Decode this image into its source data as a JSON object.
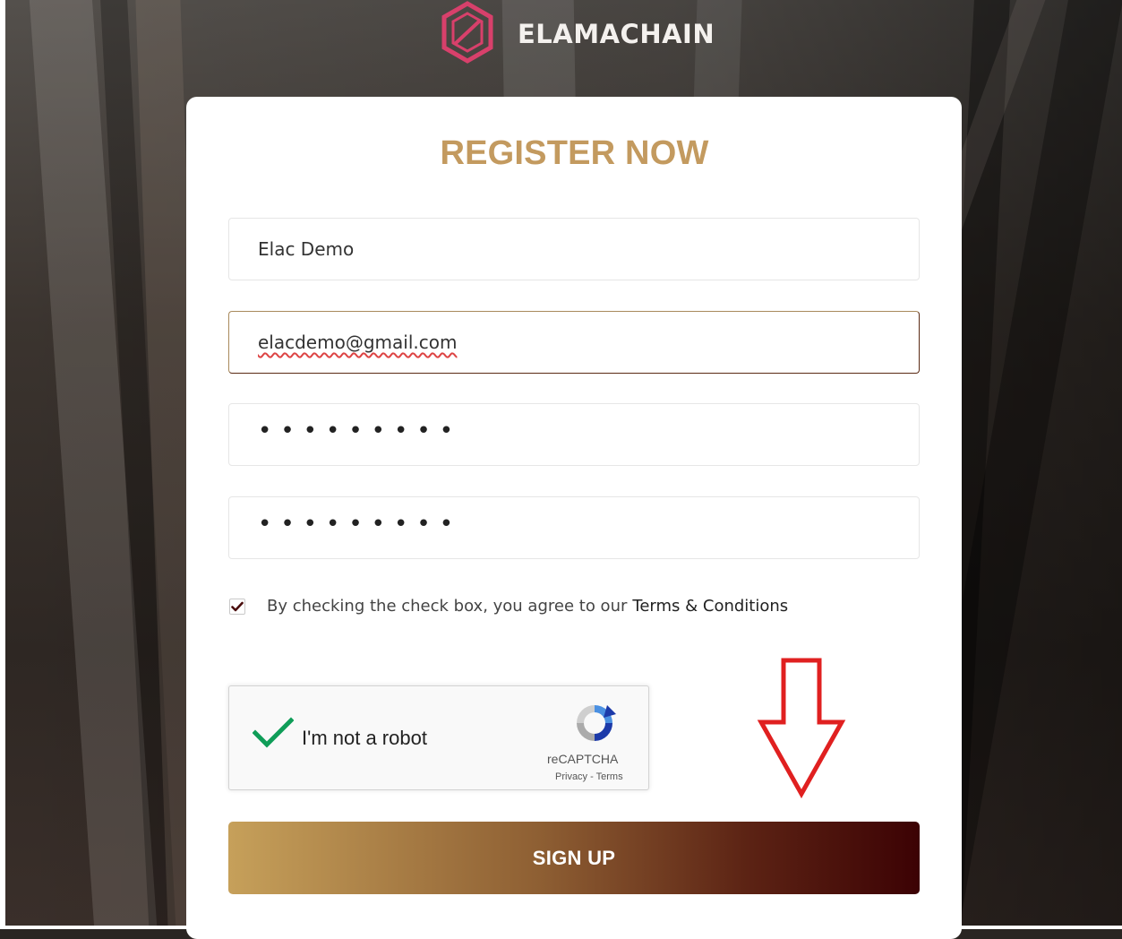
{
  "brand": {
    "name": "ELAMACHAIN",
    "logo_color": "#d8406b"
  },
  "form": {
    "title": "REGISTER NOW",
    "name_value": "Elac Demo",
    "email_value": "elacdemo@gmail.com",
    "password_mask": "•••••••••",
    "confirm_password_mask": "•••••••••",
    "terms_text": "By checking the check box, you agree to our",
    "terms_link": "Terms & Conditions",
    "terms_checked": true,
    "submit_label": "SIGN UP"
  },
  "captcha": {
    "label": "I'm not a robot",
    "brand": "reCAPTCHA",
    "links": "Privacy - Terms",
    "checked": true
  },
  "annotation": {
    "arrow_color": "#e02020",
    "arrow_icon": "down-arrow-icon"
  },
  "colors": {
    "accent": "#c39a5f",
    "button_start": "#c6a05a",
    "button_end": "#3c0204"
  }
}
